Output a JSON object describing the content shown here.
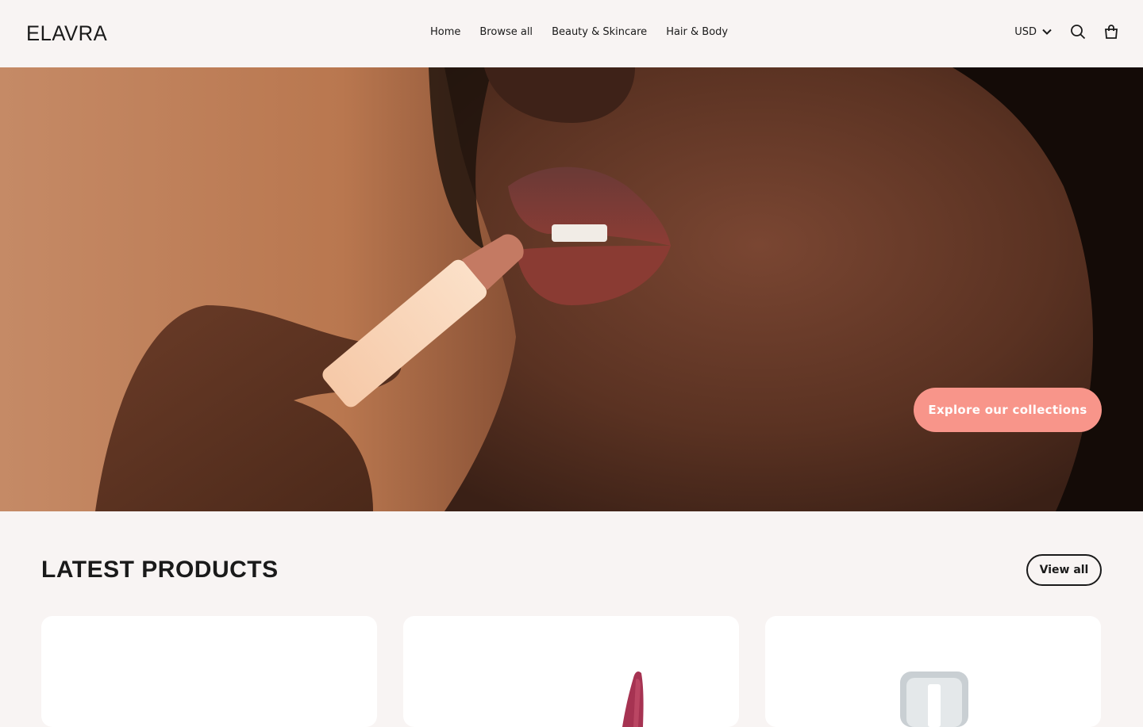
{
  "header": {
    "logo": "ELAVRA",
    "nav": [
      "Home",
      "Browse all",
      "Beauty & Skincare",
      "Hair & Body"
    ],
    "currency": "USD",
    "icons": {
      "currency_chevron": "chevron-down-icon",
      "search": "search-icon",
      "cart": "shopping-bag-icon"
    }
  },
  "hero": {
    "cta_label": "Explore our collections",
    "cta_color": "#f8958a"
  },
  "latest": {
    "title": "LATEST PRODUCTS",
    "view_all": "View all"
  },
  "colors": {
    "background": "#f8f4f3",
    "text": "#1a1a1a",
    "accent": "#f8958a"
  }
}
